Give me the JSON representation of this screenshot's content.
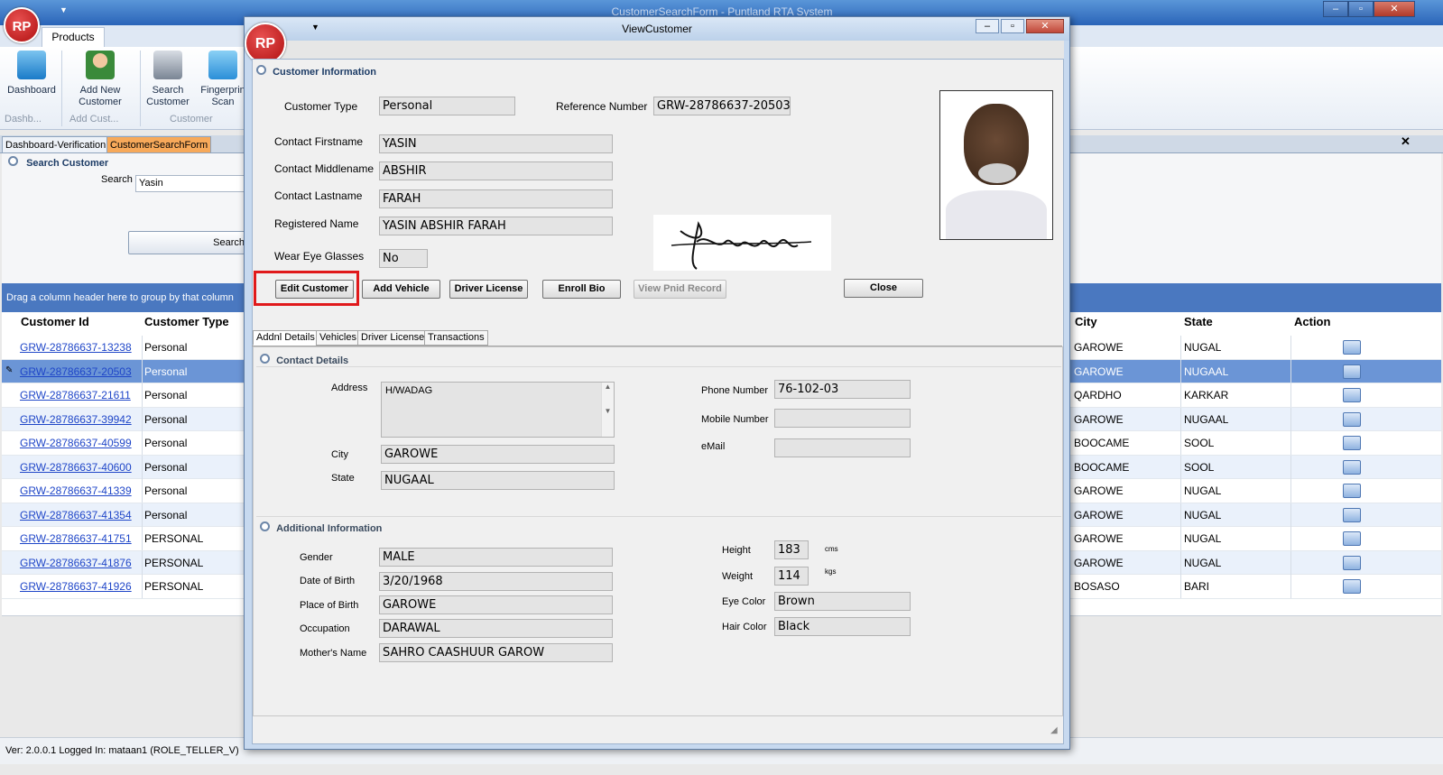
{
  "app": {
    "window_title": "CustomerSearchForm - Puntland RTA System",
    "logo_text": "RP"
  },
  "ribbon": {
    "tab": "Products",
    "buttons": [
      {
        "label": "Dashboard"
      },
      {
        "label": "Add New Customer"
      },
      {
        "label": "Search Customer"
      },
      {
        "label": "Fingerprin Scan"
      }
    ],
    "groups": [
      "Dashb...",
      "Add Cust...",
      "Customer"
    ]
  },
  "doc_tabs": [
    "Dashboard-Verification",
    "CustomerSearchForm"
  ],
  "search": {
    "title": "Search Customer",
    "label": "Search",
    "value": "Yasin",
    "button": "Search"
  },
  "grid": {
    "group_hint": "Drag a column header here to group by that column",
    "headers": {
      "id": "Customer Id",
      "type": "Customer Type",
      "city": "City",
      "state": "State",
      "action": "Action"
    },
    "rows": [
      {
        "id": "GRW-28786637-13238",
        "type": "Personal",
        "city": "GAROWE",
        "state": "NUGAL"
      },
      {
        "id": "GRW-28786637-20503",
        "type": "Personal",
        "city": "GAROWE",
        "state": "NUGAAL"
      },
      {
        "id": "GRW-28786637-21611",
        "type": "Personal",
        "city": "QARDHO",
        "state": "KARKAR"
      },
      {
        "id": "GRW-28786637-39942",
        "type": "Personal",
        "city": "GAROWE",
        "state": "NUGAAL"
      },
      {
        "id": "GRW-28786637-40599",
        "type": "Personal",
        "city": "BOOCAME",
        "state": "SOOL"
      },
      {
        "id": "GRW-28786637-40600",
        "type": "Personal",
        "city": "BOOCAME",
        "state": "SOOL"
      },
      {
        "id": "GRW-28786637-41339",
        "type": "Personal",
        "city": "GAROWE",
        "state": "NUGAL"
      },
      {
        "id": "GRW-28786637-41354",
        "type": "Personal",
        "city": "GAROWE",
        "state": "NUGAL"
      },
      {
        "id": "GRW-28786637-41751",
        "type": "PERSONAL",
        "city": "GAROWE",
        "state": "NUGAL"
      },
      {
        "id": "GRW-28786637-41876",
        "type": "PERSONAL",
        "city": "GAROWE",
        "state": "NUGAL"
      },
      {
        "id": "GRW-28786637-41926",
        "type": "PERSONAL",
        "city": "BOSASO",
        "state": "BARI"
      }
    ]
  },
  "status": {
    "text": "Ver: 2.0.0.1    Logged In: mataan1 (ROLE_TELLER_V)"
  },
  "dialog": {
    "title": "ViewCustomer",
    "section": "Customer Information",
    "customer_type_label": "Customer Type",
    "customer_type": "Personal",
    "ref_label": "Reference Number",
    "ref": "GRW-28786637-20503",
    "firstname_label": "Contact Firstname",
    "firstname": "YASIN",
    "middlename_label": "Contact Middlename",
    "middlename": "ABSHIR",
    "lastname_label": "Contact Lastname",
    "lastname": "FARAH",
    "regname_label": "Registered Name",
    "regname": "YASIN ABSHIR FARAH",
    "glasses_label": "Wear Eye Glasses",
    "glasses": "No",
    "buttons": {
      "edit": "Edit Customer",
      "vehicle": "Add Vehicle",
      "license": "Driver License",
      "bio": "Enroll Bio",
      "pnid": "View Pnid Record",
      "close": "Close"
    },
    "tabs": [
      "Addnl Details",
      "Vehicles",
      "Driver License",
      "Transactions"
    ],
    "contact": {
      "title": "Contact Details",
      "address_label": "Address",
      "address": "H/WADAG",
      "city_label": "City",
      "city": "GAROWE",
      "state_label": "State",
      "state": "NUGAAL",
      "phone_label": "Phone Number",
      "phone": "76-102-03",
      "mobile_label": "Mobile Number",
      "mobile": "",
      "email_label": "eMail",
      "email": ""
    },
    "additional": {
      "title": "Additional Information",
      "gender_label": "Gender",
      "gender": "MALE",
      "dob_label": "Date of Birth",
      "dob": "3/20/1968",
      "pob_label": "Place of Birth",
      "pob": "GAROWE",
      "occ_label": "Occupation",
      "occ": "DARAWAL",
      "mother_label": "Mother's Name",
      "mother": "SAHRO CAASHUUR GAROW",
      "height_label": "Height",
      "height": "183",
      "height_unit": "cms",
      "weight_label": "Weight",
      "weight": "114",
      "weight_unit": "kgs",
      "eye_label": "Eye Color",
      "eye": "Brown",
      "hair_label": "Hair Color",
      "hair": "Black"
    }
  },
  "colors": {
    "accent": "#4a78c0",
    "highlight_box": "#e0191b",
    "selected_row": "#6b95d6"
  }
}
